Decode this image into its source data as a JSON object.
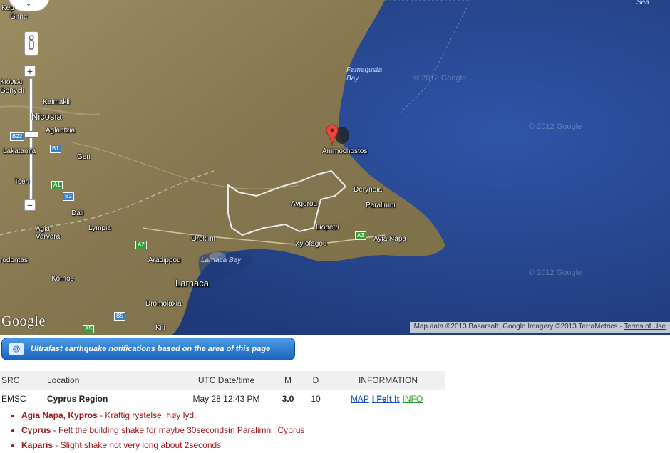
{
  "map": {
    "labels": {
      "sea": "Sea",
      "kephalos": "Kep",
      "girne": "Girne",
      "famagusta_bay": "Famagusta Bay",
      "kiovelli": "Κιόνελι",
      "gonyeli": "Gönyeli",
      "kaimakli": "Kaimakli",
      "nicosia": "Nicosia",
      "aglantzia": "Aglantzia",
      "lakatamia": "Lakatamia",
      "geri": "Geri",
      "tseri": "Tseri",
      "dali": "Dali",
      "lympia": "Lympia",
      "agia_varvara": "Agia\nVarvara",
      "rodontas": "rodontas",
      "aradippou": "Aradippou",
      "oroklini": "Oroklini",
      "larnaca_bay": "Larnaca Bay",
      "kornos": "Kornos",
      "larnaca": "Larnaca",
      "dromolaxia": "Dromolaxia",
      "kiti": "Kiti",
      "ammochostos": "Ammochostos",
      "deryneia": "Deryneia",
      "avgorou": "Avgorou",
      "paralimni": "Paralimni",
      "liopetri": "Liopetri",
      "xylofagou": "Xylofagou",
      "ayia_napa": "Ayia Napa"
    },
    "road_shields": [
      "B1",
      "B22",
      "A1",
      "B2",
      "A2",
      "A3",
      "B5",
      "A5"
    ],
    "watermarks": [
      "© 2012 Google",
      "© 2012 Google",
      "© 2012 Google"
    ],
    "google_logo": "Google",
    "attribution": "Map data ©2013 Basarsoft, Google Imagery ©2013 TerraMetrics -",
    "terms_link": "Terms of Use",
    "zoom_in": "+",
    "zoom_out": "−",
    "pan_symbol": "⌄"
  },
  "banner": {
    "text": "Ultrafast earthquake notifications based on the area of this page"
  },
  "table": {
    "headers": {
      "src": "SRC",
      "location": "Location",
      "date": "UTC Date/time",
      "m": "M",
      "d": "D",
      "info": "INFORMATION"
    },
    "row": {
      "src": "EMSC",
      "location": "Cyprus Region",
      "date": "May 28 12:43 PM",
      "m": "3.0",
      "d": "10",
      "link_map": "MAP",
      "link_felt": "I Felt It",
      "link_info": "INFO"
    }
  },
  "reports": [
    {
      "place": "Agia Napa, Kypros",
      "text": " - Kraftig rystelse, høy lyd."
    },
    {
      "place": "Cyprus",
      "text": " - Felt the building shake for maybe 30secondsin Paralimni, Cyprus"
    },
    {
      "place": "Kaparis",
      "text": " - Slight shake not very long about 2seconds"
    }
  ],
  "colors": {
    "sea": "#2a4a8e",
    "land": "#8c7d52",
    "banner": "#1b64bd",
    "report_text": "#a01818",
    "link": "#1a50b8",
    "info_link": "#2a9a2a",
    "pin": "#e8473d"
  }
}
